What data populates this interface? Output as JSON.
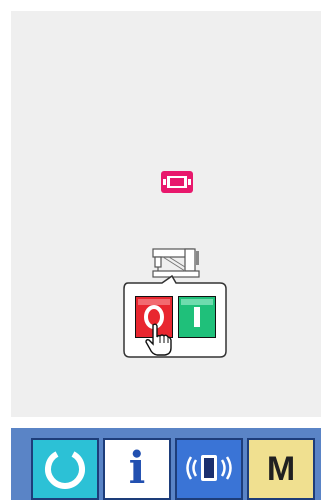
{
  "screen": {
    "status_icon": "memory-card-icon",
    "machine_icon": "sewing-machine-icon",
    "power_prompt": {
      "off_label": "O",
      "on_label": "I",
      "off_color": "#e8262f",
      "on_color": "#1fc07a",
      "pointer_icon": "hand-pointer-icon"
    }
  },
  "bottom_bar": {
    "reset_button": {
      "icon": "reset-icon",
      "color": "#2cc1d6"
    },
    "info_button": {
      "label": "i",
      "color": "#ffffff"
    },
    "communication_button": {
      "icon": "communication-icon",
      "color": "#3a74d6"
    },
    "mode_button": {
      "label": "M",
      "color": "#f0e090"
    }
  },
  "colors": {
    "accent_pink": "#e8186c",
    "bar_blue": "#5a84c6"
  }
}
